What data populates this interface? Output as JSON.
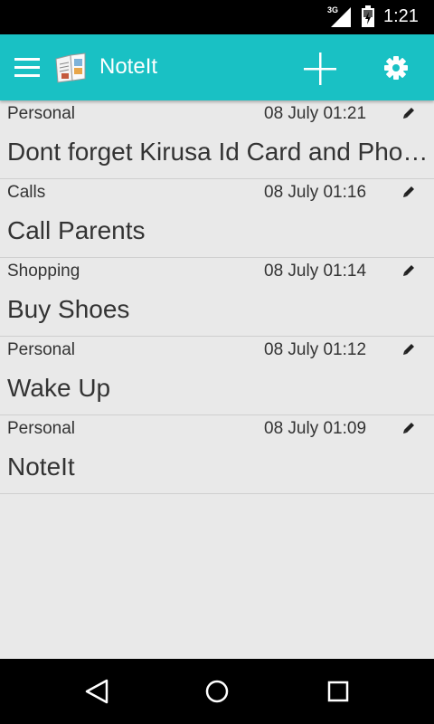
{
  "status_bar": {
    "network": "3G",
    "time": "1:21"
  },
  "app_bar": {
    "title": "NoteIt",
    "menu_icon": "hamburger-menu-icon",
    "logo_icon": "notebook-logo-icon",
    "add_icon": "plus-icon",
    "settings_icon": "gear-icon",
    "color": "#19c1c4"
  },
  "notes": [
    {
      "category": "Personal",
      "date": "08 July 01:21",
      "title": "Dont forget Kirusa Id Card and Phone"
    },
    {
      "category": "Calls",
      "date": "08 July 01:16",
      "title": "Call Parents"
    },
    {
      "category": "Shopping",
      "date": "08 July 01:14",
      "title": "Buy Shoes"
    },
    {
      "category": "Personal",
      "date": "08 July 01:12",
      "title": "Wake Up"
    },
    {
      "category": "Personal",
      "date": "08 July 01:09",
      "title": "NoteIt"
    }
  ],
  "nav_bar": {
    "back_icon": "back-triangle-icon",
    "home_icon": "home-circle-icon",
    "recents_icon": "recents-square-icon"
  }
}
